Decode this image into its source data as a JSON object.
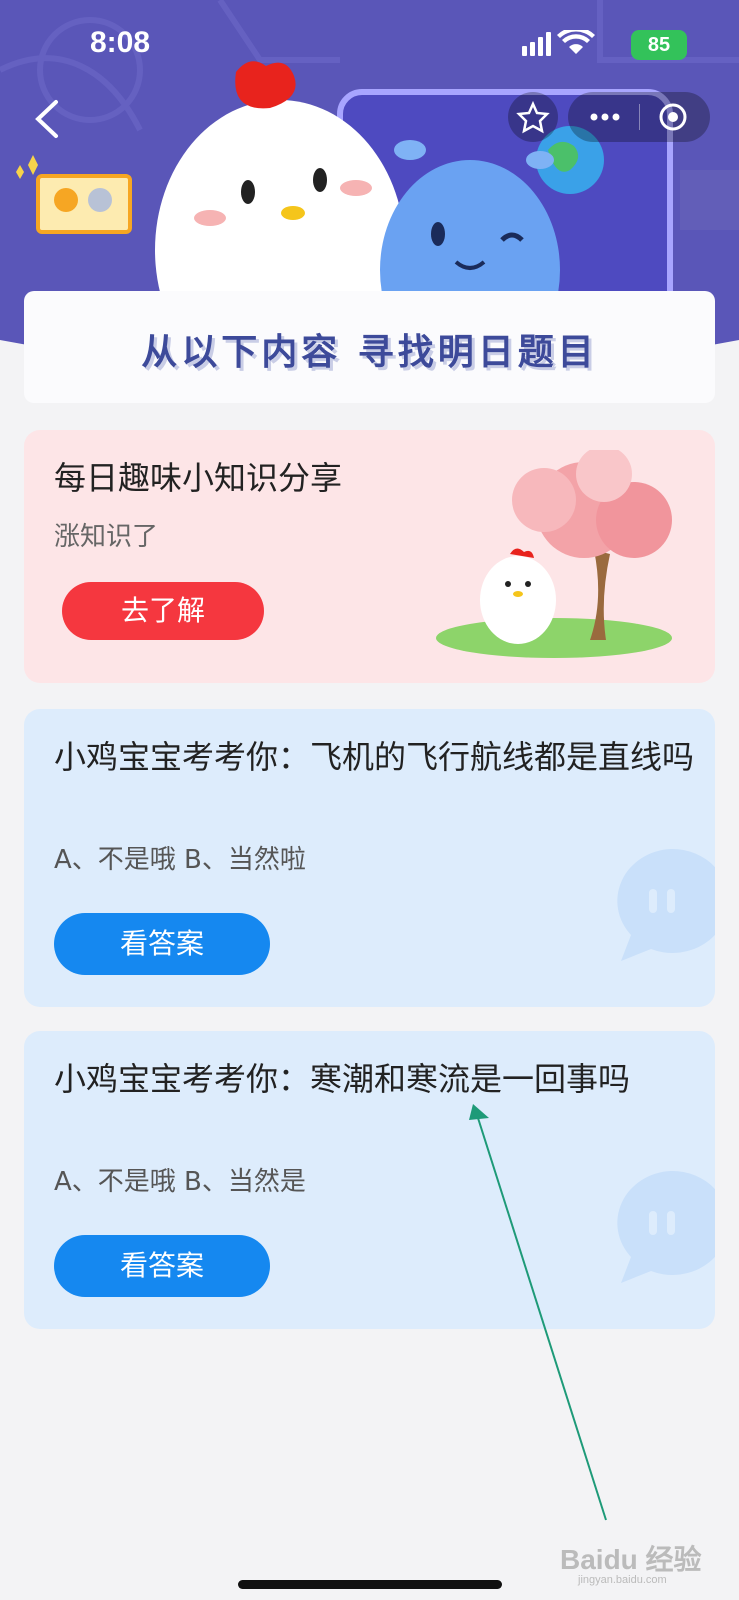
{
  "status_bar": {
    "time": "8:08",
    "battery": "85"
  },
  "banner": {
    "title": "从以下内容 寻找明日题目"
  },
  "cards": [
    {
      "title": "每日趣味小知识分享",
      "subtitle": "涨知识了",
      "button": "去了解"
    },
    {
      "title": "小鸡宝宝考考你：飞机的飞行航线都是直线吗",
      "options": "A、不是哦     B、当然啦",
      "button": "看答案"
    },
    {
      "title": "小鸡宝宝考考你：寒潮和寒流是一回事吗",
      "options": "A、不是哦     B、当然是",
      "button": "看答案"
    }
  ],
  "watermark": {
    "brand": "Baidu 经验",
    "url": "jingyan.baidu.com"
  },
  "colors": {
    "hero": "#5a56b8",
    "pink_card": "#fde5e7",
    "blue_card": "#ddecfc",
    "red_button": "#f5373f",
    "blue_button": "#1588f0",
    "arrow": "#1e9a78"
  }
}
